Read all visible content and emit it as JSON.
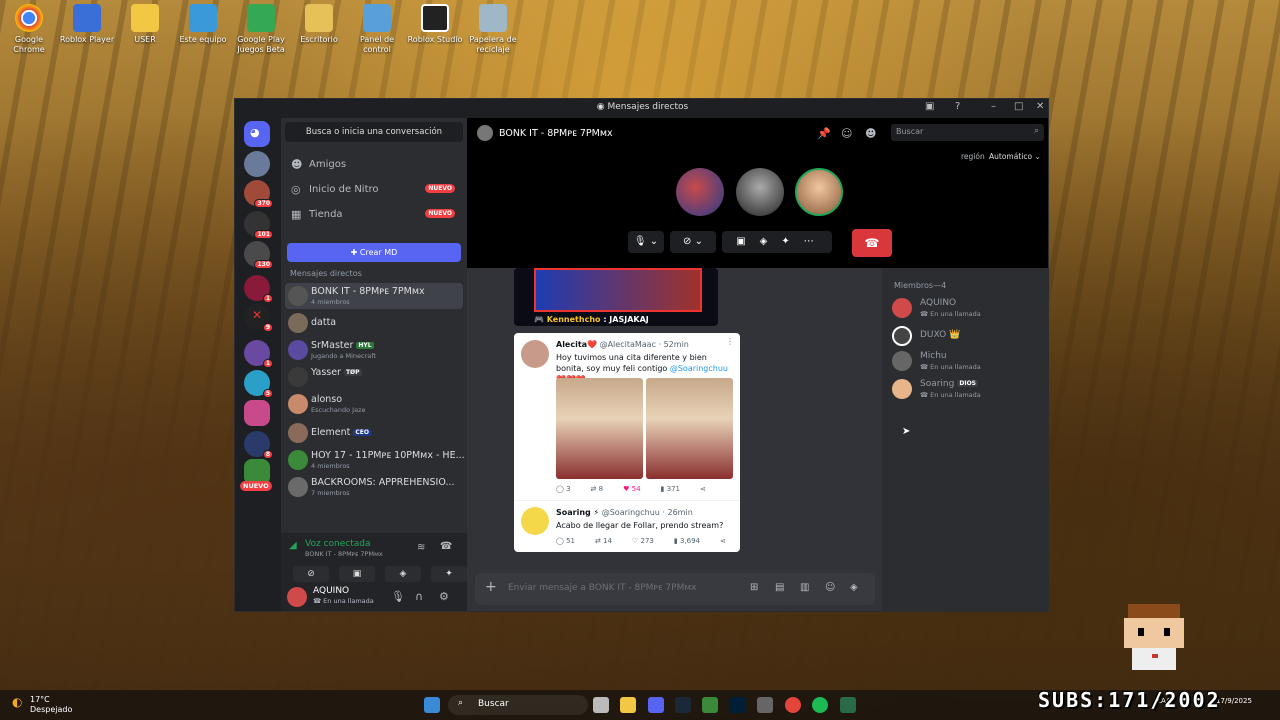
{
  "desktop": {
    "icons": [
      {
        "label": "Google Chrome",
        "color": "#e4453a"
      },
      {
        "label": "Roblox Player",
        "color": "#3a6fd8"
      },
      {
        "label": "USER",
        "color": "#f2c744"
      },
      {
        "label": "Este equipo",
        "color": "#3a9ad9"
      },
      {
        "label": "Google Play Juegos Beta",
        "color": "#34a853"
      },
      {
        "label": "Escritorio",
        "color": "#e6c15a"
      },
      {
        "label": "Panel de control",
        "color": "#5aa0d8"
      },
      {
        "label": "Roblox Studio",
        "color": "#222222"
      },
      {
        "label": "Papelera de reciclaje",
        "color": "#9fb8c8"
      }
    ]
  },
  "window": {
    "title": "Mensajes directos"
  },
  "guilds": [
    {
      "badge": ""
    },
    {
      "badge": "370"
    },
    {
      "badge": "101"
    },
    {
      "badge": "130"
    },
    {
      "badge": "1"
    },
    {
      "badge": "9"
    },
    {
      "badge": "1"
    },
    {
      "badge": "5"
    },
    {
      "badge": ""
    },
    {
      "badge": "8"
    },
    {
      "badge": "NUEVO"
    }
  ],
  "dm": {
    "search_label": "Busca o inicia una conversación",
    "nav": [
      {
        "label": "Amigos",
        "badge": ""
      },
      {
        "label": "Inicio de Nitro",
        "badge": "NUEVO"
      },
      {
        "label": "Tienda",
        "badge": "NUEVO"
      }
    ],
    "create_label": "Crear MD",
    "section_header": "Mensajes directos",
    "items": [
      {
        "name": "BONK IT - 8PMᴘᴇ 7PMᴍx",
        "sub": "4 miembros",
        "tag": ""
      },
      {
        "name": "datta",
        "sub": "",
        "tag": ""
      },
      {
        "name": "SrMaster",
        "sub": "Jugando a Minecraft",
        "tag": "HYL"
      },
      {
        "name": "Yasser",
        "sub": "",
        "tag": "TØP"
      },
      {
        "name": "alonso",
        "sub": "Escuchando Jaze",
        "tag": ""
      },
      {
        "name": "Element",
        "sub": "",
        "tag": "CEO"
      },
      {
        "name": "HOY 17 - 11PMᴘᴇ 10PMᴍx - HE...",
        "sub": "4 miembros",
        "tag": ""
      },
      {
        "name": "BACKROOMS: APPREHENSIO...",
        "sub": "7 miembros",
        "tag": ""
      }
    ]
  },
  "voice": {
    "status": "Voz conectada",
    "channel": "BONK IT - 8PMᴘᴇ 7PMᴍx"
  },
  "user": {
    "name": "AQUINO",
    "status": "En una llamada"
  },
  "header": {
    "channel": "BONK IT - 8PMᴘᴇ 7PMᴍx",
    "search_placeholder": "Buscar",
    "region_label": "región",
    "region_value": "Automático"
  },
  "call": {
    "participants": [
      {
        "color": "#b0413e"
      },
      {
        "color": "#555555"
      },
      {
        "color": "#e8b48a"
      }
    ]
  },
  "chat": {
    "image_caption_name": "Kennethcho",
    "image_caption_text": "JASJAKAJ",
    "tweets": [
      {
        "author": "Alecita❤️",
        "handle": "@AlecitaMaac · 52min",
        "text": "Hoy tuvimos una cita diferente y bien bonita, soy muy feli contigo",
        "mention": "@Soaringchuu",
        "hearts": "❤️❤️❤️",
        "replies": "3",
        "retweets": "8",
        "likes": "54",
        "views": "371"
      },
      {
        "author": "Soaring ⚡",
        "handle": "@Soaringchuu · 26min",
        "text": "Acabo de llegar de Follar, prendo stream?",
        "replies": "51",
        "retweets": "14",
        "likes": "273",
        "views": "3,694"
      }
    ],
    "composer_placeholder": "Enviar mensaje a BONK IT - 8PMᴘᴇ 7PMᴍx"
  },
  "members": {
    "header": "Miembros—4",
    "list": [
      {
        "name": "AQUINO",
        "status": "En una llamada",
        "tag": "",
        "color": "#d04a4a"
      },
      {
        "name": "DUXO",
        "status": "",
        "tag": "👑",
        "color": "#444444"
      },
      {
        "name": "Michu",
        "status": "En una llamada",
        "tag": "",
        "color": "#666666"
      },
      {
        "name": "Soaring",
        "status": "En una llamada",
        "tag": "DIOS",
        "color": "#e8b48a"
      }
    ]
  },
  "taskbar": {
    "temp": "17°C",
    "weather": "Despejado",
    "search": "Buscar",
    "lang": "LAA",
    "date": "17/9/2025"
  },
  "overlay": {
    "subs": "SUBS:171/2002"
  }
}
